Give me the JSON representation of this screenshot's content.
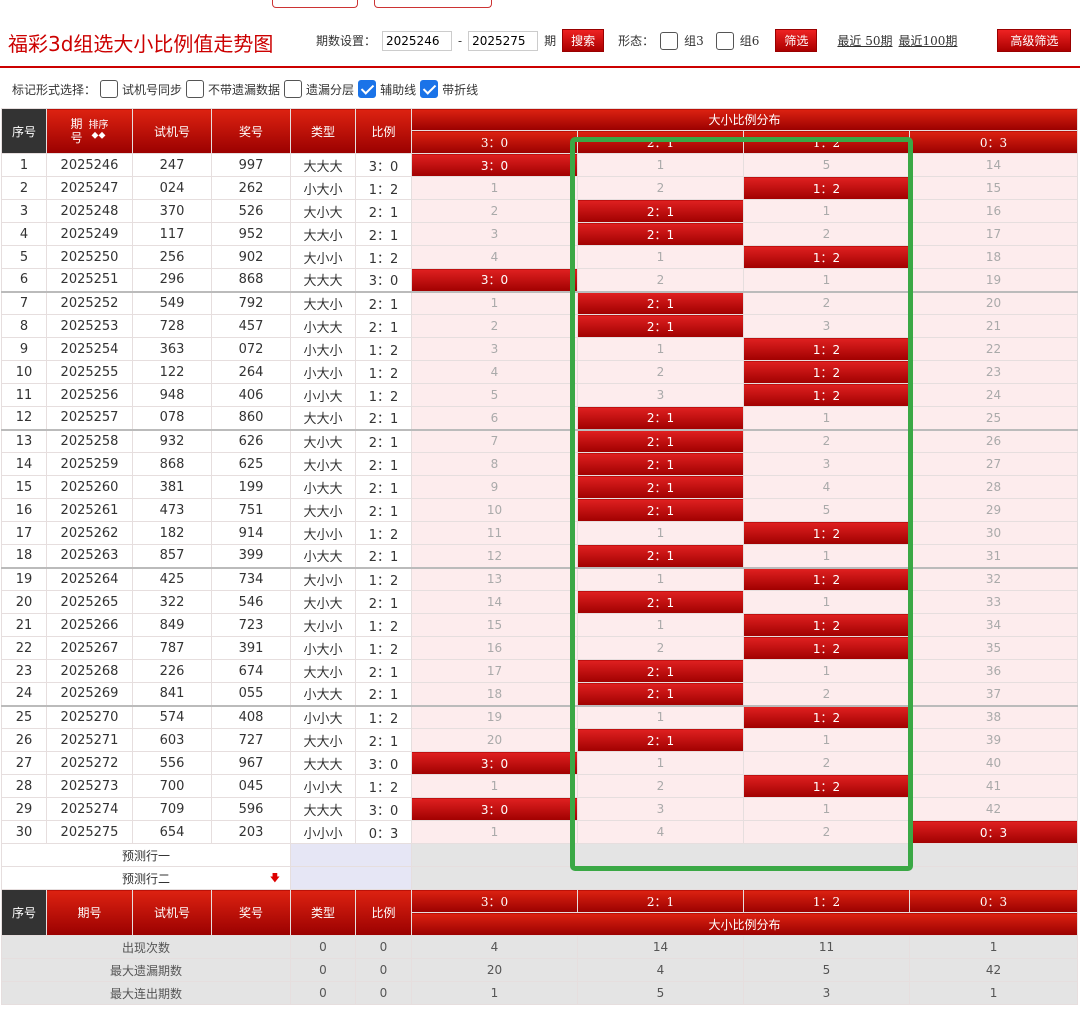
{
  "header": {
    "title": "福彩3d组选大小比例值走势图",
    "period_label": "期数设置：",
    "period_from": "2025246",
    "period_sep": "-",
    "period_to": "2025275",
    "period_unit": "期",
    "search_label": "搜索",
    "form_label": "形态：",
    "group3_label": "组3",
    "group6_label": "组6",
    "filter_label": "筛选",
    "recent50_label": "最近 50期",
    "recent100_label": "最近100期",
    "advanced_label": "高级筛选"
  },
  "markbar": {
    "label": "标记形式选择：",
    "options": [
      {
        "label": "试机号同步",
        "checked": false
      },
      {
        "label": "不带遗漏数据",
        "checked": false
      },
      {
        "label": "遗漏分层",
        "checked": false
      },
      {
        "label": "辅助线",
        "checked": true
      },
      {
        "label": "带折线",
        "checked": true
      }
    ]
  },
  "table": {
    "headers": {
      "index": "序号",
      "period_top": "期",
      "period_bottom": "号",
      "sort": "排序",
      "trial": "试机号",
      "prize": "奖号",
      "type": "类型",
      "ratio": "比例",
      "dist": "大小比例分布",
      "cats": [
        "3：0",
        "2：1",
        "1：2",
        "0：3"
      ],
      "period_plain": "期号"
    },
    "rows": [
      {
        "n": "1",
        "period": "2025246",
        "trial": "247",
        "prize": "997",
        "type": "大大大",
        "ratio": "3：0",
        "cells": [
          "3：0",
          "1",
          "5",
          "14"
        ],
        "hit": 0
      },
      {
        "n": "2",
        "period": "2025247",
        "trial": "024",
        "prize": "262",
        "type": "小大小",
        "ratio": "1：2",
        "cells": [
          "1",
          "2",
          "1：2",
          "15"
        ],
        "hit": 2
      },
      {
        "n": "3",
        "period": "2025248",
        "trial": "370",
        "prize": "526",
        "type": "大小大",
        "ratio": "2：1",
        "cells": [
          "2",
          "2：1",
          "1",
          "16"
        ],
        "hit": 1
      },
      {
        "n": "4",
        "period": "2025249",
        "trial": "117",
        "prize": "952",
        "type": "大大小",
        "ratio": "2：1",
        "cells": [
          "3",
          "2：1",
          "2",
          "17"
        ],
        "hit": 1
      },
      {
        "n": "5",
        "period": "2025250",
        "trial": "256",
        "prize": "902",
        "type": "大小小",
        "ratio": "1：2",
        "cells": [
          "4",
          "1",
          "1：2",
          "18"
        ],
        "hit": 2
      },
      {
        "n": "6",
        "period": "2025251",
        "trial": "296",
        "prize": "868",
        "type": "大大大",
        "ratio": "3：0",
        "cells": [
          "3：0",
          "2",
          "1",
          "19"
        ],
        "hit": 0
      },
      {
        "n": "7",
        "period": "2025252",
        "trial": "549",
        "prize": "792",
        "type": "大大小",
        "ratio": "2：1",
        "cells": [
          "1",
          "2：1",
          "2",
          "20"
        ],
        "hit": 1
      },
      {
        "n": "8",
        "period": "2025253",
        "trial": "728",
        "prize": "457",
        "type": "小大大",
        "ratio": "2：1",
        "cells": [
          "2",
          "2：1",
          "3",
          "21"
        ],
        "hit": 1
      },
      {
        "n": "9",
        "period": "2025254",
        "trial": "363",
        "prize": "072",
        "type": "小大小",
        "ratio": "1：2",
        "cells": [
          "3",
          "1",
          "1：2",
          "22"
        ],
        "hit": 2
      },
      {
        "n": "10",
        "period": "2025255",
        "trial": "122",
        "prize": "264",
        "type": "小大小",
        "ratio": "1：2",
        "cells": [
          "4",
          "2",
          "1：2",
          "23"
        ],
        "hit": 2
      },
      {
        "n": "11",
        "period": "2025256",
        "trial": "948",
        "prize": "406",
        "type": "小小大",
        "ratio": "1：2",
        "cells": [
          "5",
          "3",
          "1：2",
          "24"
        ],
        "hit": 2
      },
      {
        "n": "12",
        "period": "2025257",
        "trial": "078",
        "prize": "860",
        "type": "大大小",
        "ratio": "2：1",
        "cells": [
          "6",
          "2：1",
          "1",
          "25"
        ],
        "hit": 1
      },
      {
        "n": "13",
        "period": "2025258",
        "trial": "932",
        "prize": "626",
        "type": "大小大",
        "ratio": "2：1",
        "cells": [
          "7",
          "2：1",
          "2",
          "26"
        ],
        "hit": 1
      },
      {
        "n": "14",
        "period": "2025259",
        "trial": "868",
        "prize": "625",
        "type": "大小大",
        "ratio": "2：1",
        "cells": [
          "8",
          "2：1",
          "3",
          "27"
        ],
        "hit": 1
      },
      {
        "n": "15",
        "period": "2025260",
        "trial": "381",
        "prize": "199",
        "type": "小大大",
        "ratio": "2：1",
        "cells": [
          "9",
          "2：1",
          "4",
          "28"
        ],
        "hit": 1
      },
      {
        "n": "16",
        "period": "2025261",
        "trial": "473",
        "prize": "751",
        "type": "大大小",
        "ratio": "2：1",
        "cells": [
          "10",
          "2：1",
          "5",
          "29"
        ],
        "hit": 1
      },
      {
        "n": "17",
        "period": "2025262",
        "trial": "182",
        "prize": "914",
        "type": "大小小",
        "ratio": "1：2",
        "cells": [
          "11",
          "1",
          "1：2",
          "30"
        ],
        "hit": 2
      },
      {
        "n": "18",
        "period": "2025263",
        "trial": "857",
        "prize": "399",
        "type": "小大大",
        "ratio": "2：1",
        "cells": [
          "12",
          "2：1",
          "1",
          "31"
        ],
        "hit": 1
      },
      {
        "n": "19",
        "period": "2025264",
        "trial": "425",
        "prize": "734",
        "type": "大小小",
        "ratio": "1：2",
        "cells": [
          "13",
          "1",
          "1：2",
          "32"
        ],
        "hit": 2
      },
      {
        "n": "20",
        "period": "2025265",
        "trial": "322",
        "prize": "546",
        "type": "大小大",
        "ratio": "2：1",
        "cells": [
          "14",
          "2：1",
          "1",
          "33"
        ],
        "hit": 1
      },
      {
        "n": "21",
        "period": "2025266",
        "trial": "849",
        "prize": "723",
        "type": "大小小",
        "ratio": "1：2",
        "cells": [
          "15",
          "1",
          "1：2",
          "34"
        ],
        "hit": 2
      },
      {
        "n": "22",
        "period": "2025267",
        "trial": "787",
        "prize": "391",
        "type": "小大小",
        "ratio": "1：2",
        "cells": [
          "16",
          "2",
          "1：2",
          "35"
        ],
        "hit": 2
      },
      {
        "n": "23",
        "period": "2025268",
        "trial": "226",
        "prize": "674",
        "type": "大大小",
        "ratio": "2：1",
        "cells": [
          "17",
          "2：1",
          "1",
          "36"
        ],
        "hit": 1
      },
      {
        "n": "24",
        "period": "2025269",
        "trial": "841",
        "prize": "055",
        "type": "小大大",
        "ratio": "2：1",
        "cells": [
          "18",
          "2：1",
          "2",
          "37"
        ],
        "hit": 1
      },
      {
        "n": "25",
        "period": "2025270",
        "trial": "574",
        "prize": "408",
        "type": "小小大",
        "ratio": "1：2",
        "cells": [
          "19",
          "1",
          "1：2",
          "38"
        ],
        "hit": 2
      },
      {
        "n": "26",
        "period": "2025271",
        "trial": "603",
        "prize": "727",
        "type": "大大小",
        "ratio": "2：1",
        "cells": [
          "20",
          "2：1",
          "1",
          "39"
        ],
        "hit": 1
      },
      {
        "n": "27",
        "period": "2025272",
        "trial": "556",
        "prize": "967",
        "type": "大大大",
        "ratio": "3：0",
        "cells": [
          "3：0",
          "1",
          "2",
          "40"
        ],
        "hit": 0
      },
      {
        "n": "28",
        "period": "2025273",
        "trial": "700",
        "prize": "045",
        "type": "小小大",
        "ratio": "1：2",
        "cells": [
          "1",
          "2",
          "1：2",
          "41"
        ],
        "hit": 2
      },
      {
        "n": "29",
        "period": "2025274",
        "trial": "709",
        "prize": "596",
        "type": "大大大",
        "ratio": "3：0",
        "cells": [
          "3：0",
          "3",
          "1",
          "42"
        ],
        "hit": 0
      },
      {
        "n": "30",
        "period": "2025275",
        "trial": "654",
        "prize": "203",
        "type": "小小小",
        "ratio": "0：3",
        "cells": [
          "1",
          "4",
          "2",
          "0：3"
        ],
        "hit": 3
      }
    ],
    "predict1": "预测行一",
    "predict2": "预测行二",
    "stats": [
      {
        "label": "出现次数",
        "type": "0",
        "ratio": "0",
        "cells": [
          "4",
          "14",
          "11",
          "1"
        ]
      },
      {
        "label": "最大遗漏期数",
        "type": "0",
        "ratio": "0",
        "cells": [
          "20",
          "4",
          "5",
          "42"
        ]
      },
      {
        "label": "最大连出期数",
        "type": "0",
        "ratio": "0",
        "cells": [
          "1",
          "5",
          "3",
          "1"
        ]
      }
    ]
  },
  "colors": {
    "accent": "#c00000",
    "highlight": "#3aa845",
    "checkbox": "#1a73e8"
  }
}
